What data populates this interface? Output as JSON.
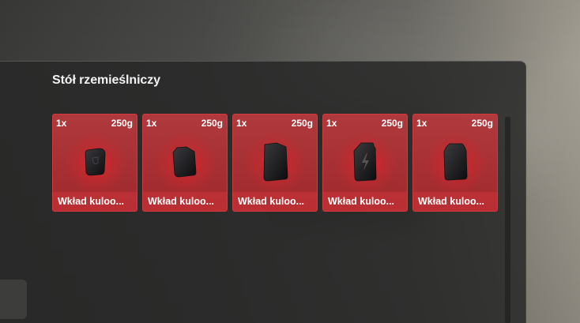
{
  "panel": {
    "title": "Stół rzemieślniczy"
  },
  "items": [
    {
      "quantity": "1x",
      "weight": "250g",
      "name": "Wkład kuloo...",
      "icon": "armor-plate-small-icon"
    },
    {
      "quantity": "1x",
      "weight": "250g",
      "name": "Wkład kuloo...",
      "icon": "armor-plate-icon"
    },
    {
      "quantity": "1x",
      "weight": "250g",
      "name": "Wkład kuloo...",
      "icon": "armor-plate-large-icon"
    },
    {
      "quantity": "1x",
      "weight": "250g",
      "name": "Wkład kuloo...",
      "icon": "armor-plate-lightning-icon"
    },
    {
      "quantity": "1x",
      "weight": "250g",
      "name": "Wkład kuloo...",
      "icon": "armor-plate-heavy-icon"
    }
  ],
  "colors": {
    "accent_red": "#d6383c",
    "panel_bg": "#262726",
    "text": "#ffffff"
  }
}
